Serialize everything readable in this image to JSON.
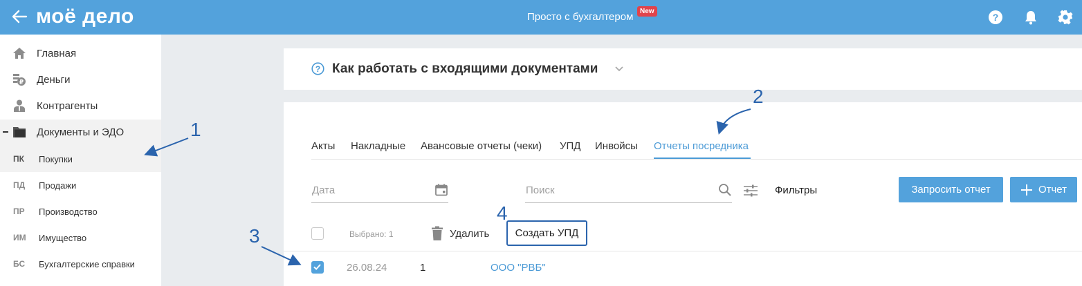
{
  "topbar": {
    "logo": "моё дело",
    "center_title": "Просто с бухгалтером",
    "badge": "New",
    "icons": [
      "help-icon",
      "bell-icon",
      "gear-icon"
    ],
    "color": "#53a2dc"
  },
  "sidebar": {
    "items": [
      {
        "label": "Главная",
        "icon": "home-icon"
      },
      {
        "label": "Деньги",
        "icon": "money-icon"
      },
      {
        "label": "Контрагенты",
        "icon": "contractors-icon"
      },
      {
        "label": "Документы и ЭДО",
        "icon": "folder-icon",
        "expanded": true
      }
    ],
    "subitems": [
      {
        "abbr": "ПК",
        "label": "Покупки",
        "active": true
      },
      {
        "abbr": "ПД",
        "label": "Продажи"
      },
      {
        "abbr": "ПР",
        "label": "Производство"
      },
      {
        "abbr": "ИМ",
        "label": "Имущество"
      },
      {
        "abbr": "БС",
        "label": "Бухгалтерские справки"
      }
    ]
  },
  "help_panel": {
    "title": "Как работать с входящими документами"
  },
  "tabs": [
    {
      "label": "Акты"
    },
    {
      "label": "Накладные"
    },
    {
      "label": "Авансовые отчеты (чеки)"
    },
    {
      "label": "УПД"
    },
    {
      "label": "Инвойсы"
    },
    {
      "label": "Отчеты посредника",
      "active": true
    }
  ],
  "toolbar": {
    "date_placeholder": "Дата",
    "search_placeholder": "Поиск",
    "filters_label": "Фильтры",
    "request_report_label": "Запросить отчет",
    "add_report_label": "Отчет"
  },
  "bulk_actions": {
    "selected_label": "Выбрано: 1",
    "delete_label": "Удалить",
    "create_upd_label": "Создать УПД"
  },
  "rows": [
    {
      "date": "26.08.24",
      "number": "1",
      "counterparty": "ООО \"РВБ\"",
      "checked": true
    }
  ],
  "annotations": {
    "n1": "1",
    "n2": "2",
    "n3": "3",
    "n4": "4",
    "color": "#2b64ad"
  }
}
